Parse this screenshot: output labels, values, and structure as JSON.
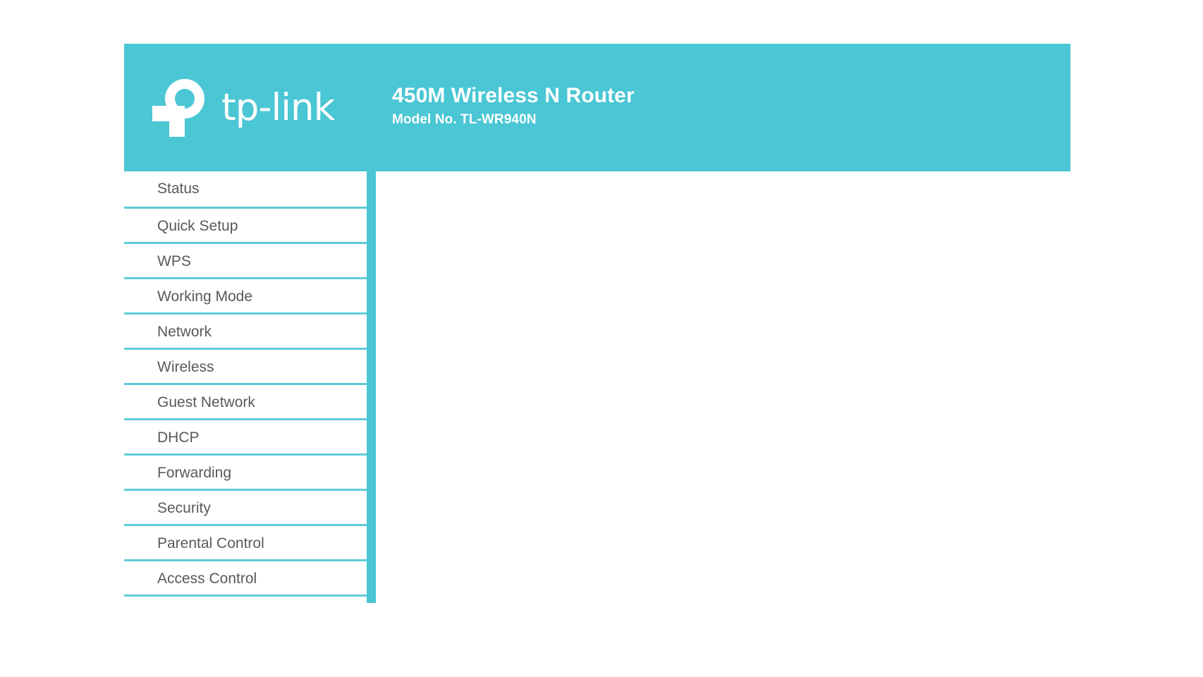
{
  "header": {
    "brand": {
      "logo_icon": "tp-link-logo-icon",
      "wordmark": "tp-link"
    },
    "title": "450M Wireless N Router",
    "subtitle": "Model No. TL-WR940N"
  },
  "sidebar": {
    "items": [
      {
        "label": "Status"
      },
      {
        "label": "Quick Setup"
      },
      {
        "label": "WPS"
      },
      {
        "label": "Working Mode"
      },
      {
        "label": "Network"
      },
      {
        "label": "Wireless"
      },
      {
        "label": "Guest Network"
      },
      {
        "label": "DHCP"
      },
      {
        "label": "Forwarding"
      },
      {
        "label": "Security"
      },
      {
        "label": "Parental Control"
      },
      {
        "label": "Access Control"
      }
    ]
  },
  "colors": {
    "brand_teal": "#4ac6d4",
    "divider_teal": "#5ecbd8",
    "menu_text": "#595959",
    "page_background": "#ffffff"
  }
}
